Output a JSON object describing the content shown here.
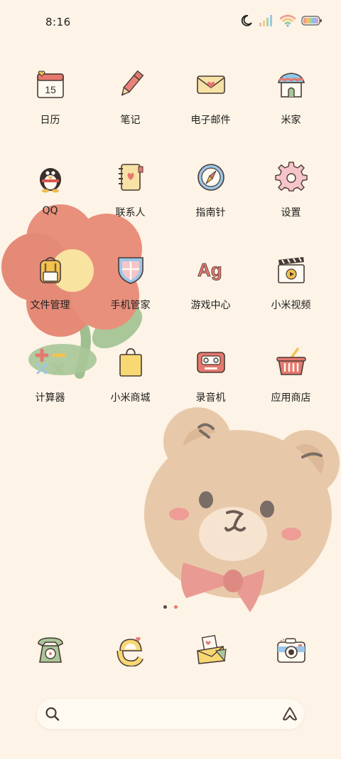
{
  "status_bar": {
    "time": "8:16",
    "icons": [
      "moon-icon",
      "signal-icon",
      "wifi-icon",
      "battery-icon"
    ]
  },
  "apps": [
    [
      {
        "label": "日历",
        "icon": "calendar-icon",
        "calendar_day": "15"
      },
      {
        "label": "笔记",
        "icon": "pencil-icon"
      },
      {
        "label": "电子邮件",
        "icon": "envelope-icon"
      },
      {
        "label": "米家",
        "icon": "house-icon"
      }
    ],
    [
      {
        "label": "QQ",
        "icon": "penguin-icon"
      },
      {
        "label": "联系人",
        "icon": "contacts-book-icon"
      },
      {
        "label": "指南针",
        "icon": "compass-icon"
      },
      {
        "label": "设置",
        "icon": "gear-icon"
      }
    ],
    [
      {
        "label": "文件管理",
        "icon": "backpack-icon"
      },
      {
        "label": "手机管家",
        "icon": "shield-icon"
      },
      {
        "label": "游戏中心",
        "icon": "game-letters-icon",
        "icon_text": "Ag"
      },
      {
        "label": "小米视频",
        "icon": "clapperboard-icon"
      }
    ],
    [
      {
        "label": "计算器",
        "icon": "calculator-icon"
      },
      {
        "label": "小米商城",
        "icon": "shopping-bag-icon"
      },
      {
        "label": "录音机",
        "icon": "recorder-icon"
      },
      {
        "label": "应用商店",
        "icon": "basket-icon"
      }
    ]
  ],
  "page_indicator": {
    "total": 2,
    "current": 2
  },
  "dock": [
    {
      "icon": "phone-icon"
    },
    {
      "icon": "browser-icon"
    },
    {
      "icon": "messages-icon"
    },
    {
      "icon": "camera-icon"
    }
  ],
  "search": {
    "left_icon": "search-icon",
    "right_icon": "assistant-icon"
  },
  "colors": {
    "background": "#fdf3e6",
    "flower_petal": "#e8907c",
    "flower_center": "#f9e3a0",
    "leaf": "#9fbf8f",
    "bear": "#e7c9a9",
    "bow": "#e99a92"
  }
}
